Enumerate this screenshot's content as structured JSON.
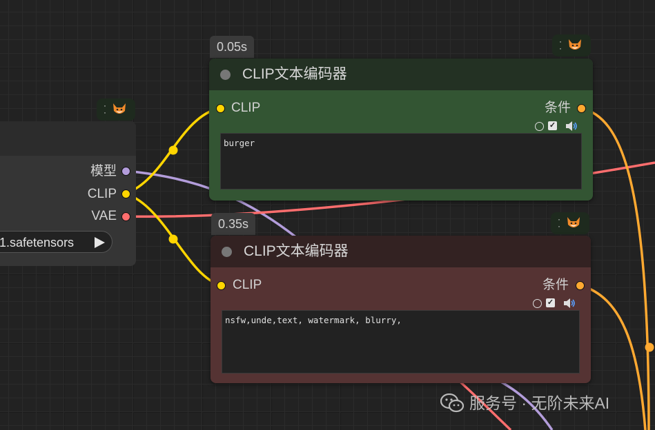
{
  "colors": {
    "clip_wire": "#ffd500",
    "model_wire": "#b39ddb",
    "vae_wire": "#ff6e6e",
    "conditioning_wire": "#ffa931",
    "positive_node_title": "#233123",
    "positive_node_body": "#335533",
    "negative_node_title": "#332222",
    "negative_node_body": "#553333"
  },
  "loader": {
    "outputs": [
      {
        "label": "模型",
        "color": "#b39ddb"
      },
      {
        "label": "CLIP",
        "color": "#ffd500"
      },
      {
        "label": "VAE",
        "color": "#ff6e6e"
      }
    ],
    "ckpt_value": "1.safetensors",
    "ckpt_arrow_icon": "play-triangle-icon",
    "badge_icon": "fox-icon"
  },
  "positive_node": {
    "timing": "0.05s",
    "title": "CLIP文本编码器",
    "input_label": "CLIP",
    "output_label": "条件",
    "text": "burger",
    "badge_icon": "fox-icon"
  },
  "negative_node": {
    "timing": "0.35s",
    "title": "CLIP文本编码器",
    "input_label": "CLIP",
    "output_label": "条件",
    "text": "nsfw,unde,text, watermark, blurry,",
    "badge_icon": "fox-icon"
  },
  "watermark": {
    "icon": "wechat-icon",
    "text": "服务号 · 无阶未来AI"
  }
}
